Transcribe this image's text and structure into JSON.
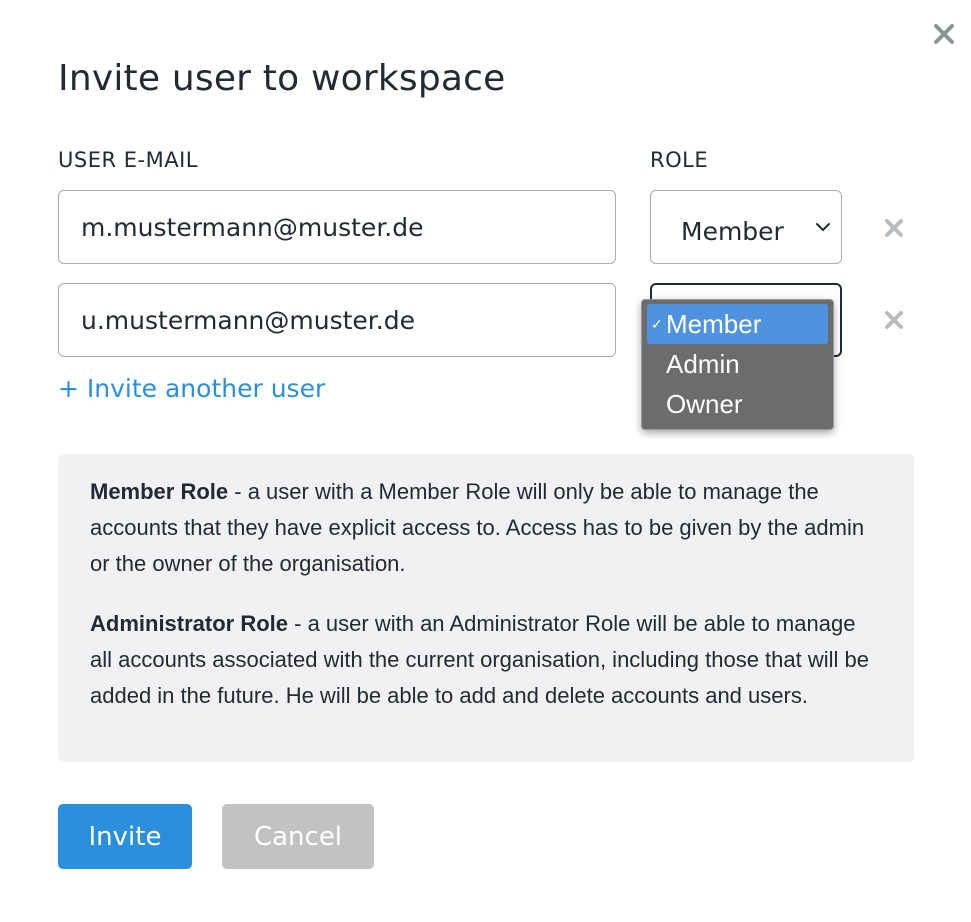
{
  "dialog": {
    "title": "Invite user to workspace",
    "close_icon": "close-icon"
  },
  "columns": {
    "email_label": "USER E-MAIL",
    "role_label": "ROLE"
  },
  "rows": [
    {
      "email": "m.mustermann@muster.de",
      "role": "Member"
    },
    {
      "email": "u.mustermann@muster.de",
      "role": ""
    }
  ],
  "role_dropdown": {
    "open": true,
    "options": [
      "Member",
      "Admin",
      "Owner"
    ],
    "selected": "Member",
    "check_mark": "✓"
  },
  "add_user_label": "+ Invite another user",
  "info": {
    "member_title": "Member Role",
    "member_text": " - a user with a Member Role will only be able to manage the accounts that they have explicit access to. Access has to be given by the admin or the owner of the organisation.",
    "admin_title": "Administrator Role",
    "admin_text": " - a user with an Administrator Role will be able to manage all accounts associated with the current organisation, including those that will be added in the future. He will be able to add and delete accounts and users."
  },
  "buttons": {
    "invite": "Invite",
    "cancel": "Cancel"
  },
  "colors": {
    "accent": "#2a8fdc",
    "text": "#222a35",
    "disabled_button": "#c2c2c2",
    "info_background": "#f1f1f3",
    "dropdown_selected": "#4f92df"
  }
}
